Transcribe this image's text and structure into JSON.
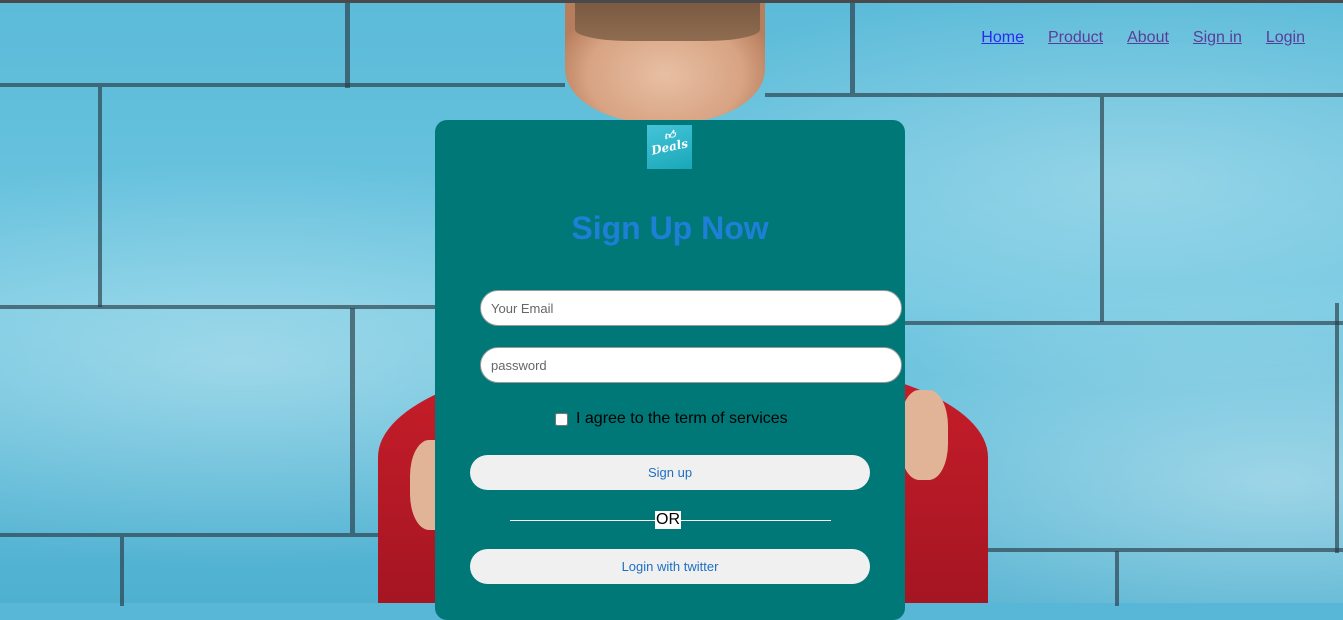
{
  "nav": {
    "items": [
      {
        "label": "Home"
      },
      {
        "label": "Product"
      },
      {
        "label": "About"
      },
      {
        "label": "Sign in"
      },
      {
        "label": "Login"
      }
    ]
  },
  "form": {
    "logo_text": "Deals",
    "title": "Sign Up Now",
    "email_placeholder": "Your Email",
    "password_placeholder": "password",
    "agree_label": "I agree to the term of services",
    "signup_label": "Sign up",
    "or_text": "OR",
    "twitter_label": "Login with twitter"
  },
  "colors": {
    "card": "#007878",
    "title": "#1e7fd6",
    "link": "#2a2af0",
    "button_bg": "#f0f0f0"
  }
}
